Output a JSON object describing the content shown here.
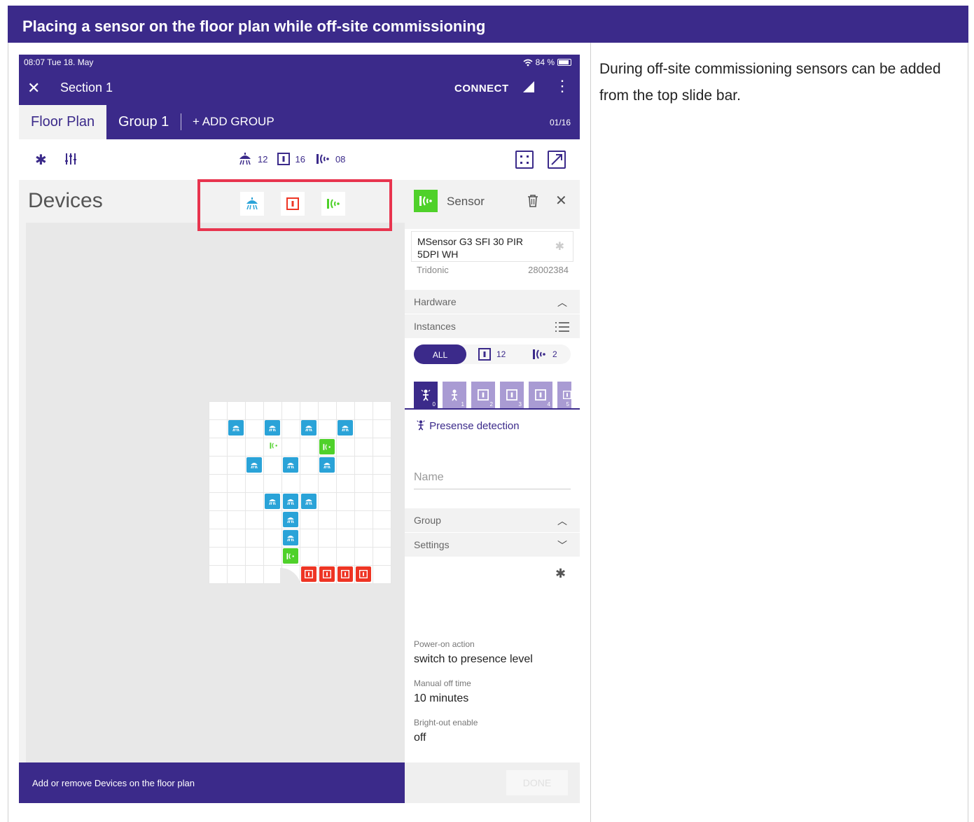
{
  "banner": {
    "title": "Placing a sensor on the floor plan while off-site commissioning"
  },
  "description": "During off-site commissioning sensors can be added from the top slide bar.",
  "statusbar": {
    "time": "08:07  Tue 18. May",
    "battery": "84 %"
  },
  "header": {
    "close_icon": "close-icon",
    "section": "Section 1",
    "connect": "CONNECT"
  },
  "tabs": {
    "floor_plan": "Floor Plan",
    "group1": "Group 1",
    "add_group": "ADD GROUP",
    "counter": "01/16"
  },
  "toolbar": {
    "lamps": "12",
    "switches": "16",
    "sensors": "08"
  },
  "devices_title": "Devices",
  "footer": {
    "hint": "Add or remove Devices on the floor plan",
    "done": "DONE"
  },
  "panel": {
    "title": "Sensor",
    "product_line1": "MSensor G3 SFI 30 PIR",
    "product_line2": "5DPI WH",
    "brand": "Tridonic",
    "article": "28002384",
    "hardware": "Hardware",
    "instances": "Instances",
    "filter_all": "ALL",
    "filter_switch_count": "12",
    "filter_sensor_count": "2",
    "instance_numbers": [
      "0",
      "1",
      "2",
      "3",
      "4",
      "5"
    ],
    "presence": "Presense detection",
    "name_placeholder": "Name",
    "group": "Group",
    "settings": "Settings",
    "power_on_label": "Power-on action",
    "power_on_value": "switch to presence level",
    "manual_off_label": "Manual off time",
    "manual_off_value": "10 minutes",
    "bright_out_label": "Bright-out enable",
    "bright_out_value": "off"
  },
  "colors": {
    "brand": "#3b2a8a",
    "lamp": "#2aa3d8",
    "switch": "#ee3524",
    "sensor": "#4fd12a",
    "highlight": "#e8344e"
  }
}
